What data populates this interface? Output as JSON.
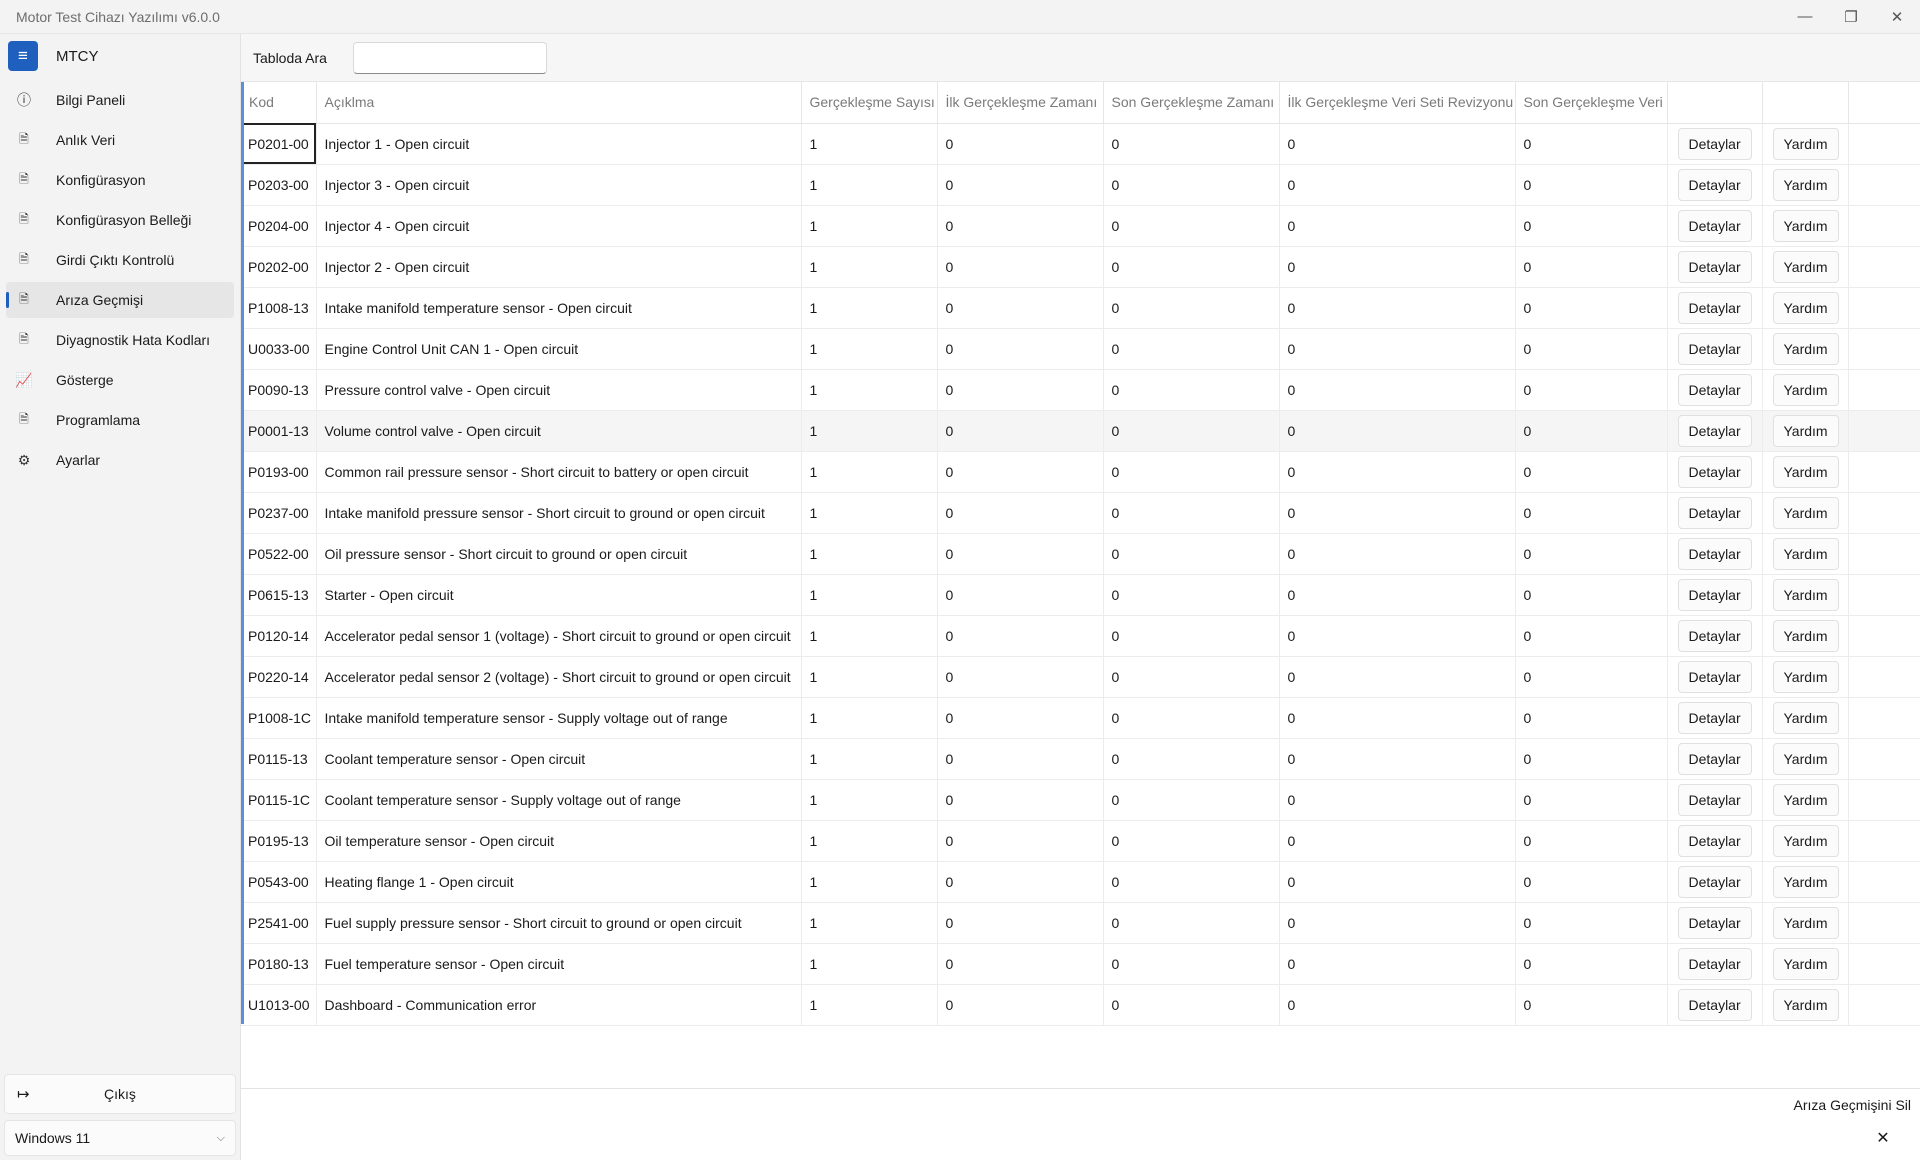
{
  "window": {
    "title": "Motor Test Cihazı Yazılımı v6.0.0"
  },
  "sidebar": {
    "app_name": "MTCY",
    "items": [
      {
        "label": "Bilgi Paneli",
        "icon": "info-icon"
      },
      {
        "label": "Anlık Veri",
        "icon": "document-icon"
      },
      {
        "label": "Konfigürasyon",
        "icon": "document-icon"
      },
      {
        "label": "Konfigürasyon Belleği",
        "icon": "document-icon"
      },
      {
        "label": "Girdi Çıktı Kontrolü",
        "icon": "document-icon"
      },
      {
        "label": "Arıza Geçmişi",
        "icon": "document-icon",
        "active": true
      },
      {
        "label": "Diyagnostik Hata Kodları",
        "icon": "document-icon"
      },
      {
        "label": "Gösterge",
        "icon": "chart-icon"
      },
      {
        "label": "Programlama",
        "icon": "document-icon"
      },
      {
        "label": "Ayarlar",
        "icon": "gear-icon"
      }
    ],
    "exit_label": "Çıkış",
    "os_select": "Windows 11"
  },
  "search": {
    "label": "Tabloda Ara",
    "value": ""
  },
  "table": {
    "columns": [
      "Kod",
      "Açıklma",
      "Gerçekleşme Sayısı",
      "İlk Gerçekleşme Zamanı",
      "Son Gerçekleşme Zamanı",
      "İlk Gerçekleşme Veri Seti Revizyonu",
      "Son Gerçekleşme Veri",
      "",
      "",
      ""
    ],
    "details_label": "Detaylar",
    "help_label": "Yardım",
    "rows": [
      {
        "code": "P0201-00",
        "desc": "Injector 1 - Open circuit",
        "count": "1",
        "first_time": "0",
        "last_time": "0",
        "first_rev": "0",
        "last_rev": "0"
      },
      {
        "code": "P0203-00",
        "desc": "Injector 3 - Open circuit",
        "count": "1",
        "first_time": "0",
        "last_time": "0",
        "first_rev": "0",
        "last_rev": "0"
      },
      {
        "code": "P0204-00",
        "desc": "Injector 4 - Open circuit",
        "count": "1",
        "first_time": "0",
        "last_time": "0",
        "first_rev": "0",
        "last_rev": "0"
      },
      {
        "code": "P0202-00",
        "desc": "Injector 2 - Open circuit",
        "count": "1",
        "first_time": "0",
        "last_time": "0",
        "first_rev": "0",
        "last_rev": "0"
      },
      {
        "code": "P1008-13",
        "desc": "Intake manifold temperature sensor - Open circuit",
        "count": "1",
        "first_time": "0",
        "last_time": "0",
        "first_rev": "0",
        "last_rev": "0"
      },
      {
        "code": "U0033-00",
        "desc": "Engine Control Unit CAN 1 - Open circuit",
        "count": "1",
        "first_time": "0",
        "last_time": "0",
        "first_rev": "0",
        "last_rev": "0"
      },
      {
        "code": "P0090-13",
        "desc": "Pressure control valve - Open circuit",
        "count": "1",
        "first_time": "0",
        "last_time": "0",
        "first_rev": "0",
        "last_rev": "0"
      },
      {
        "code": "P0001-13",
        "desc": "Volume control valve - Open circuit",
        "count": "1",
        "first_time": "0",
        "last_time": "0",
        "first_rev": "0",
        "last_rev": "0"
      },
      {
        "code": "P0193-00",
        "desc": "Common rail pressure sensor - Short circuit to battery or open circuit",
        "count": "1",
        "first_time": "0",
        "last_time": "0",
        "first_rev": "0",
        "last_rev": "0"
      },
      {
        "code": "P0237-00",
        "desc": "Intake manifold pressure sensor - Short circuit to ground or open circuit",
        "count": "1",
        "first_time": "0",
        "last_time": "0",
        "first_rev": "0",
        "last_rev": "0"
      },
      {
        "code": "P0522-00",
        "desc": "Oil pressure sensor - Short circuit to ground or open circuit",
        "count": "1",
        "first_time": "0",
        "last_time": "0",
        "first_rev": "0",
        "last_rev": "0"
      },
      {
        "code": "P0615-13",
        "desc": "Starter - Open circuit",
        "count": "1",
        "first_time": "0",
        "last_time": "0",
        "first_rev": "0",
        "last_rev": "0"
      },
      {
        "code": "P0120-14",
        "desc": "Accelerator pedal sensor 1 (voltage) - Short circuit to ground or open circuit",
        "count": "1",
        "first_time": "0",
        "last_time": "0",
        "first_rev": "0",
        "last_rev": "0"
      },
      {
        "code": "P0220-14",
        "desc": "Accelerator pedal sensor 2 (voltage) - Short circuit to ground or open circuit",
        "count": "1",
        "first_time": "0",
        "last_time": "0",
        "first_rev": "0",
        "last_rev": "0"
      },
      {
        "code": "P1008-1C",
        "desc": "Intake manifold temperature sensor - Supply voltage out of range",
        "count": "1",
        "first_time": "0",
        "last_time": "0",
        "first_rev": "0",
        "last_rev": "0"
      },
      {
        "code": "P0115-13",
        "desc": "Coolant temperature sensor - Open circuit",
        "count": "1",
        "first_time": "0",
        "last_time": "0",
        "first_rev": "0",
        "last_rev": "0"
      },
      {
        "code": "P0115-1C",
        "desc": "Coolant temperature sensor - Supply voltage out of range",
        "count": "1",
        "first_time": "0",
        "last_time": "0",
        "first_rev": "0",
        "last_rev": "0"
      },
      {
        "code": "P0195-13",
        "desc": "Oil temperature sensor - Open circuit",
        "count": "1",
        "first_time": "0",
        "last_time": "0",
        "first_rev": "0",
        "last_rev": "0"
      },
      {
        "code": "P0543-00",
        "desc": "Heating flange 1 - Open circuit",
        "count": "1",
        "first_time": "0",
        "last_time": "0",
        "first_rev": "0",
        "last_rev": "0"
      },
      {
        "code": "P2541-00",
        "desc": "Fuel supply pressure sensor - Short circuit to ground or open circuit",
        "count": "1",
        "first_time": "0",
        "last_time": "0",
        "first_rev": "0",
        "last_rev": "0"
      },
      {
        "code": "P0180-13",
        "desc": "Fuel temperature sensor - Open circuit",
        "count": "1",
        "first_time": "0",
        "last_time": "0",
        "first_rev": "0",
        "last_rev": "0"
      },
      {
        "code": "U1013-00",
        "desc": "Dashboard - Communication error",
        "count": "1",
        "first_time": "0",
        "last_time": "0",
        "first_rev": "0",
        "last_rev": "0"
      }
    ]
  },
  "footer": {
    "clear_label": "Arıza Geçmişini Sil",
    "clear_icon": "close-icon"
  }
}
